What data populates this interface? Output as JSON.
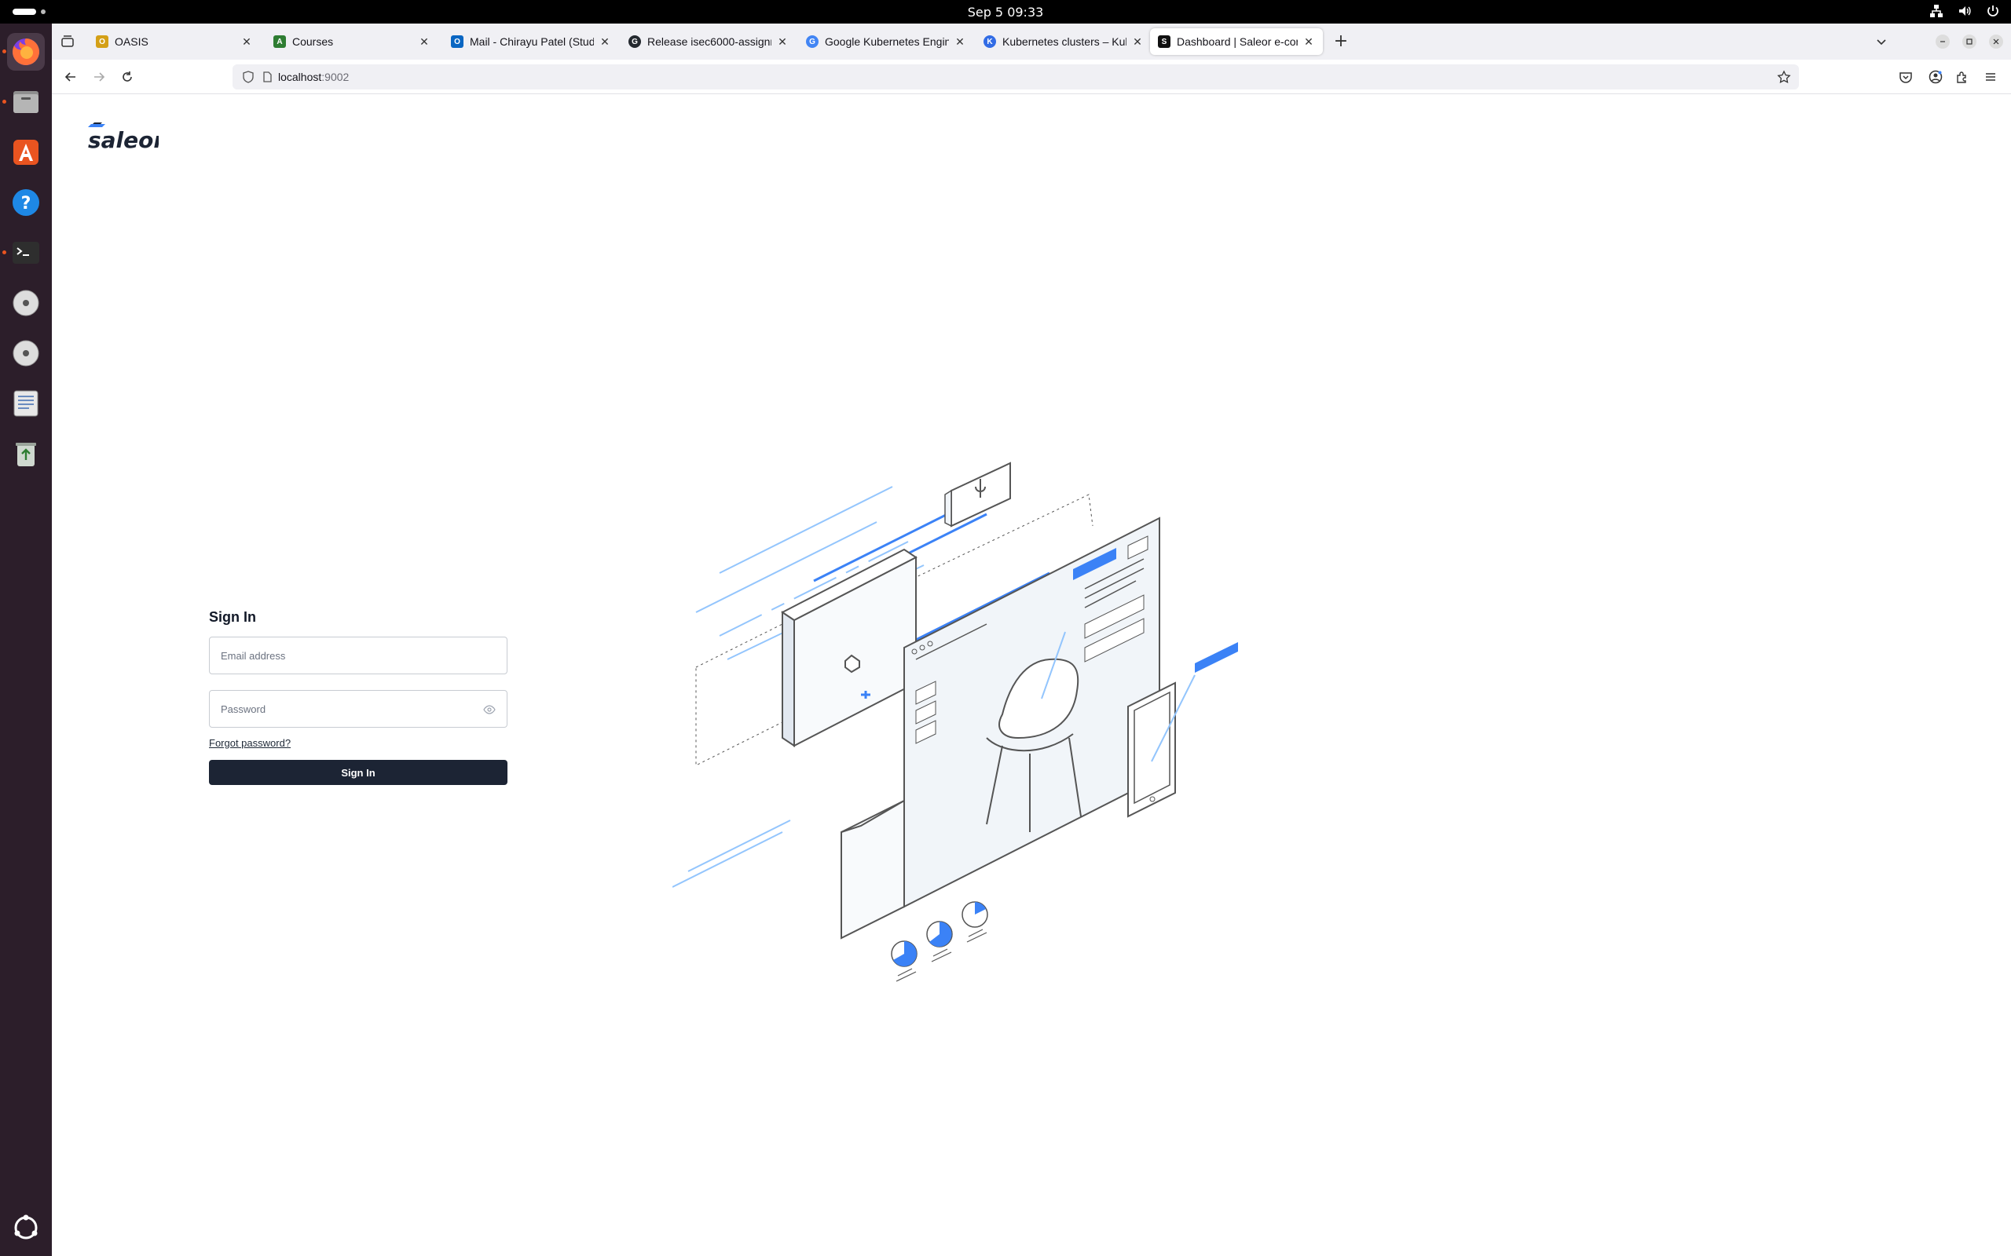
{
  "system": {
    "clock": "Sep 5  09:33"
  },
  "dock": {
    "items": [
      {
        "name": "firefox-icon"
      },
      {
        "name": "files-icon"
      },
      {
        "name": "app-center-icon"
      },
      {
        "name": "help-icon"
      },
      {
        "name": "terminal-icon"
      },
      {
        "name": "disc-icon"
      },
      {
        "name": "disc-icon-2"
      },
      {
        "name": "text-editor-icon"
      },
      {
        "name": "trash-icon"
      },
      {
        "name": "show-apps-icon"
      }
    ]
  },
  "browser": {
    "tabs": [
      {
        "label": "OASIS",
        "fav_color": "#d4a017",
        "fav_text": "O"
      },
      {
        "label": "Courses",
        "fav_color": "#2e7d32",
        "fav_text": "A"
      },
      {
        "label": "Mail - Chirayu Patel (Stud",
        "fav_color": "#0a66c2",
        "fav_text": "O"
      },
      {
        "label": "Release isec6000-assignm",
        "fav_color": "#24292f",
        "fav_text": "G"
      },
      {
        "label": "Google Kubernetes Engin",
        "fav_color": "#4285f4",
        "fav_text": "G"
      },
      {
        "label": "Kubernetes clusters – Kul",
        "fav_color": "#326ce5",
        "fav_text": "K"
      },
      {
        "label": "Dashboard | Saleor e-com",
        "fav_color": "#111111",
        "fav_text": "S",
        "active": true
      }
    ],
    "new_tab": "+",
    "url_host": "localhost",
    "url_port": ":9002"
  },
  "page": {
    "logo_text": "saleor",
    "signin": {
      "title": "Sign In",
      "email_placeholder": "Email address",
      "password_placeholder": "Password",
      "forgot": "Forgot password?",
      "button": "Sign In"
    }
  },
  "colors": {
    "accent_blue": "#3b82f6",
    "button_dark": "#1c2434",
    "dock_bg": "#2c1e2a"
  }
}
